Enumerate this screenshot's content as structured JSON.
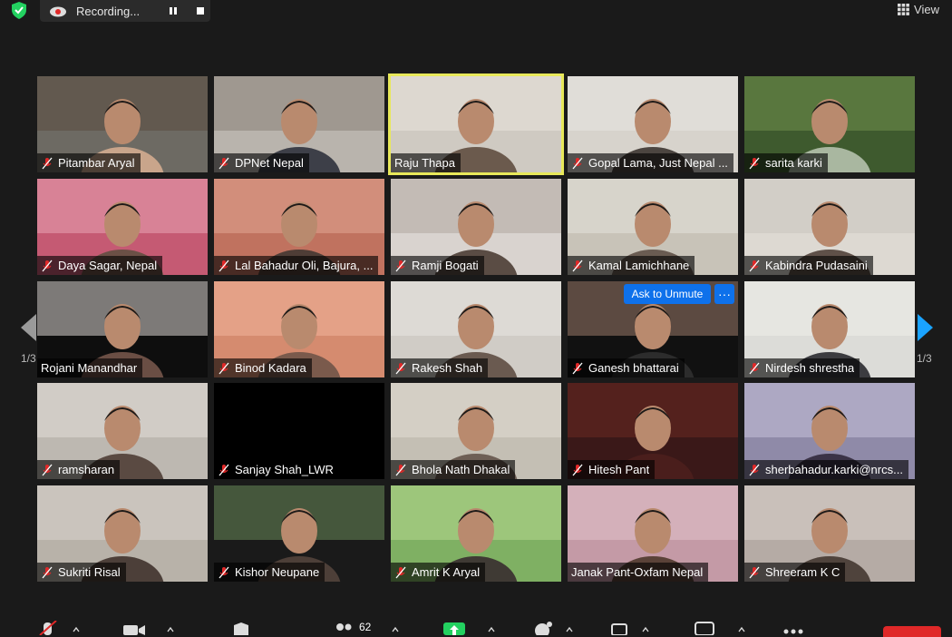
{
  "top_bar": {
    "recording_label": "Recording...",
    "view_label": "View"
  },
  "gallery": {
    "page_label_left": "1/3",
    "page_label_right": "1/3",
    "unmute_label": "Ask to Unmute",
    "more_label": "···",
    "participants": [
      {
        "name": "Pitambar Aryal",
        "muted": true
      },
      {
        "name": "DPNet Nepal",
        "muted": true
      },
      {
        "name": "Raju Thapa",
        "muted": false,
        "active_speaker": true
      },
      {
        "name": "Gopal Lama, Just Nepal ...",
        "muted": true
      },
      {
        "name": "sarita karki",
        "muted": true
      },
      {
        "name": "Daya Sagar, Nepal",
        "muted": true
      },
      {
        "name": "Lal Bahadur Oli, Bajura, ...",
        "muted": true
      },
      {
        "name": "Ramji Bogati",
        "muted": true
      },
      {
        "name": "Kamal Lamichhane",
        "muted": true
      },
      {
        "name": "Kabindra Pudasaini",
        "muted": true
      },
      {
        "name": "Rojani Manandhar",
        "muted": false
      },
      {
        "name": "Binod Kadara",
        "muted": true
      },
      {
        "name": "Rakesh Shah",
        "muted": true
      },
      {
        "name": "Ganesh bhattarai",
        "muted": true
      },
      {
        "name": "Nirdesh shrestha",
        "muted": true
      },
      {
        "name": "ramsharan",
        "muted": true
      },
      {
        "name": "Sanjay Shah_LWR",
        "muted": true
      },
      {
        "name": "Bhola Nath Dhakal",
        "muted": true
      },
      {
        "name": "Hitesh Pant",
        "muted": true
      },
      {
        "name": "sherbahadur.karki@nrcs...",
        "muted": true
      },
      {
        "name": "Sukriti Risal",
        "muted": true
      },
      {
        "name": "Kishor Neupane",
        "muted": true
      },
      {
        "name": "Amrit K Aryal",
        "muted": true
      },
      {
        "name": "Janak Pant-Oxfam Nepal",
        "muted": false
      },
      {
        "name": "Shreeram K C",
        "muted": true
      }
    ]
  },
  "toolbar": {
    "participants_count": "62"
  },
  "colors": {
    "active_border": "#e8e85a",
    "unmute_blue": "#0e71eb",
    "mute_red": "#e02828",
    "shield_green": "#23d160"
  }
}
